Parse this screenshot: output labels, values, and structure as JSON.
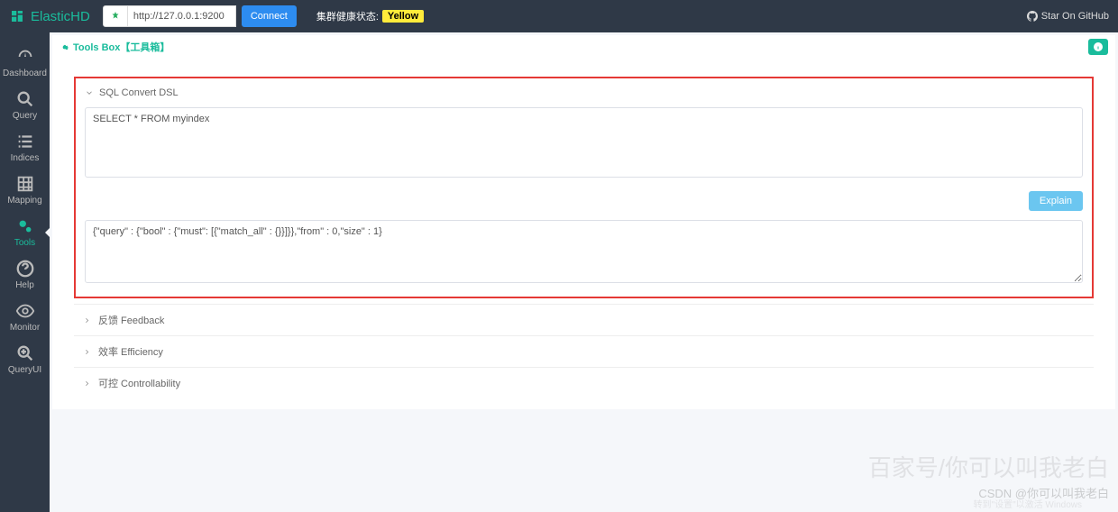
{
  "topbar": {
    "app_name": "ElasticHD",
    "url_value": "http://127.0.0.1:9200",
    "connect_label": "Connect",
    "health_label": "集群健康状态:",
    "health_status": "Yellow",
    "github_label": "Star On GitHub"
  },
  "sidebar": {
    "items": [
      {
        "label": "Dashboard"
      },
      {
        "label": "Query"
      },
      {
        "label": "Indices"
      },
      {
        "label": "Mapping"
      },
      {
        "label": "Tools"
      },
      {
        "label": "Help"
      },
      {
        "label": "Monitor"
      },
      {
        "label": "QueryUI"
      }
    ]
  },
  "panel": {
    "title": "Tools Box【工具箱】"
  },
  "sql_convert": {
    "title": "SQL Convert DSL",
    "sql_value": "SELECT * FROM myindex",
    "explain_label": "Explain",
    "dsl_value": "{\"query\" : {\"bool\" : {\"must\": [{\"match_all\" : {}}]}},\"from\" : 0,\"size\" : 1}"
  },
  "collapsed_sections": [
    {
      "label": "反馈 Feedback"
    },
    {
      "label": "效率 Efficiency"
    },
    {
      "label": "可控 Controllability"
    }
  ],
  "watermarks": {
    "wm1": "百家号/你可以叫我老白",
    "wm2": "CSDN @你可以叫我老白",
    "wm3": "转到\"设置\"以激活 Windows"
  }
}
